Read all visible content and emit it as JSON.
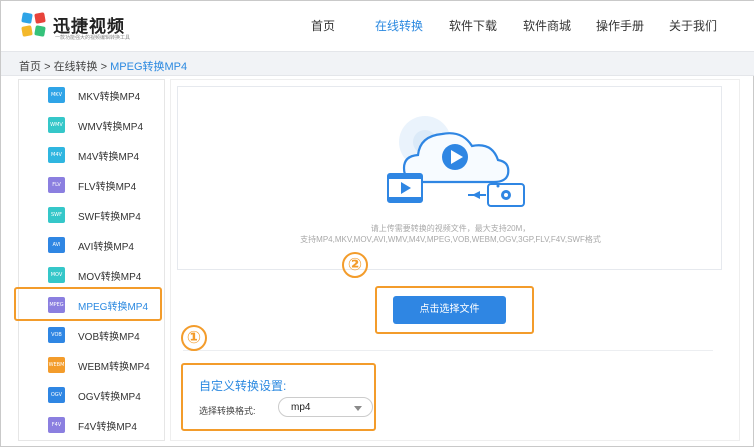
{
  "header": {
    "logo_text": "迅捷视频",
    "logo_sub": "一款功能强大的视频编辑转换工具",
    "nav": [
      {
        "label": "首页",
        "active": false
      },
      {
        "label": "在线转换",
        "active": true
      },
      {
        "label": "软件下载",
        "active": false
      },
      {
        "label": "软件商城",
        "active": false
      },
      {
        "label": "操作手册",
        "active": false
      },
      {
        "label": "关于我们",
        "active": false
      }
    ]
  },
  "breadcrumb": {
    "home": "首页",
    "sep1": ">",
    "section": "在线转换",
    "sep2": ">",
    "current": "MPEG转换MP4"
  },
  "sidebar": {
    "items": [
      {
        "badge": "MKV",
        "label": "MKV转换MP4",
        "color": "#2fa4e7",
        "active": false
      },
      {
        "badge": "WMV",
        "label": "WMV转换MP4",
        "color": "#35c7c9",
        "active": false
      },
      {
        "badge": "M4V",
        "label": "M4V转换MP4",
        "color": "#2fb6e0",
        "active": false
      },
      {
        "badge": "FLV",
        "label": "FLV转换MP4",
        "color": "#8b7fe0",
        "active": false
      },
      {
        "badge": "SWF",
        "label": "SWF转换MP4",
        "color": "#35c7c9",
        "active": false
      },
      {
        "badge": "AVI",
        "label": "AVI转换MP4",
        "color": "#2f86e3",
        "active": false
      },
      {
        "badge": "MOV",
        "label": "MOV转换MP4",
        "color": "#35c7c9",
        "active": false
      },
      {
        "badge": "MPEG",
        "label": "MPEG转换MP4",
        "color": "#8b7fe0",
        "active": true
      },
      {
        "badge": "VOB",
        "label": "VOB转换MP4",
        "color": "#2f86e3",
        "active": false
      },
      {
        "badge": "WEBM",
        "label": "WEBM转换MP4",
        "color": "#f39c2b",
        "active": false
      },
      {
        "badge": "OGV",
        "label": "OGV转换MP4",
        "color": "#2f86e3",
        "active": false
      },
      {
        "badge": "F4V",
        "label": "F4V转换MP4",
        "color": "#8b7fe0",
        "active": false
      }
    ]
  },
  "upload": {
    "hint_line1": "请上传需要转换的视频文件，最大支持20M，",
    "hint_line2": "支持MP4,MKV,MOV,AVI,WMV,M4V,MPEG,VOB,WEBM,OGV,3GP,FLV,F4V,SWF格式",
    "choose_button": "点击选择文件"
  },
  "annotations": {
    "step1": "①",
    "step2": "②",
    "highlight_color": "#f39c2b"
  },
  "settings": {
    "title": "自定义转换设置:",
    "format_label": "选择转换格式:",
    "format_value": "mp4"
  },
  "colors": {
    "accent": "#2b89e0",
    "button": "#2f86e3"
  }
}
